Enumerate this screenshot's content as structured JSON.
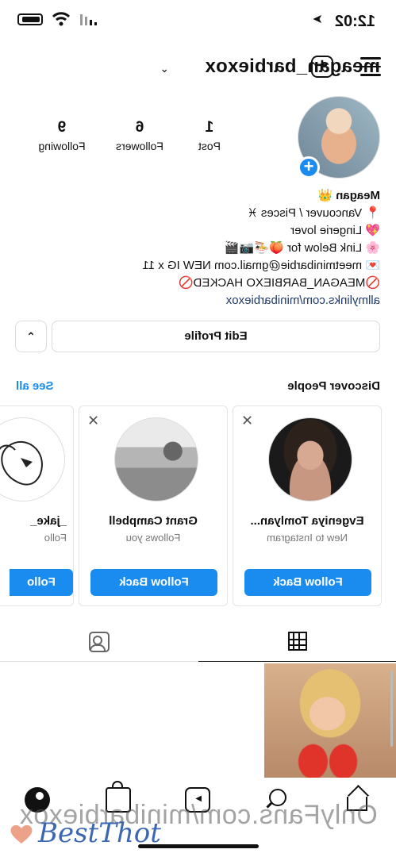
{
  "status": {
    "time": "12:02",
    "location_glyph": "➤"
  },
  "header": {
    "username": "meagan_barbiexox",
    "chevron": "⌄",
    "plus_symbol": "+"
  },
  "profile": {
    "add_symbol": "+",
    "stats": [
      {
        "value": "1",
        "label": "Post"
      },
      {
        "value": "6",
        "label": "Followers"
      },
      {
        "value": "9",
        "label": "Following"
      }
    ],
    "bio": {
      "name": "Meagan 👑",
      "lines": [
        "📍 Vancouver / Pisces ♓",
        "💖 Lingerie lover",
        "🌸 Link Below for 🍑🍜📷🎬",
        "💌 meetminibarbie@gmail.com NEW IG x 11",
        "🚫MEAGAN_BARBIEXO HACKED🚫"
      ],
      "link": "allmylinks.com/minibarbiexox"
    }
  },
  "buttons": {
    "edit_profile": "Edit Profile",
    "discover_toggle": "⌃"
  },
  "discover": {
    "title": "Discover People",
    "see_all": "See all",
    "cards": [
      {
        "name": "Grant Campbell",
        "subtitle": "Follows you",
        "button": "Follow Back",
        "close": "✕"
      },
      {
        "name": "Evgeniya Tomlyan...",
        "subtitle": "New to Instagram",
        "button": "Follow Back",
        "close": "✕"
      },
      {
        "name": "_jake_",
        "subtitle": "Follo",
        "button": "Follo",
        "close": ""
      }
    ]
  },
  "watermark": {
    "text": "OnlyFans.com/minibarbiexox",
    "logo": "BestThot"
  },
  "colors": {
    "accent": "#1a8cf0",
    "text": "#111111",
    "border": "#dbdbdb"
  }
}
